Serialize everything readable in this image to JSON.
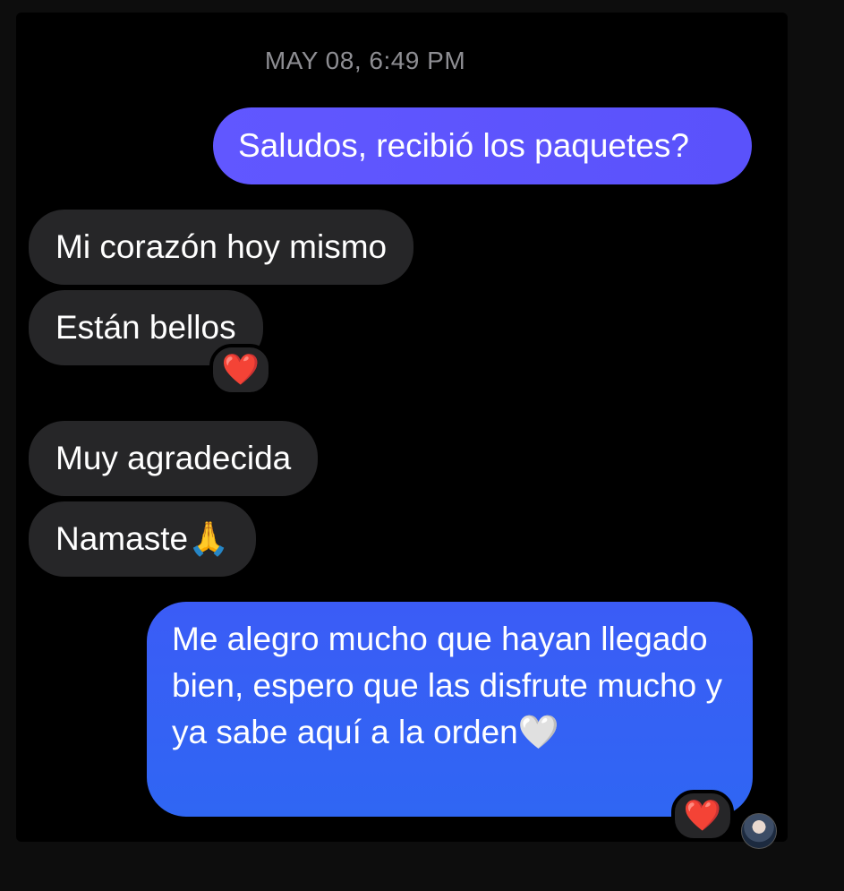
{
  "conversation": {
    "timestamp": "MAY 08, 6:49 PM",
    "messages": [
      {
        "direction": "outgoing",
        "text": "Saludos, recibió los paquetes?"
      },
      {
        "direction": "incoming",
        "text": "Mi corazón hoy mismo"
      },
      {
        "direction": "incoming",
        "text": "Están bellos",
        "reaction": "❤️"
      },
      {
        "direction": "incoming",
        "text": "Muy agradecida"
      },
      {
        "direction": "incoming",
        "text": "Namaste",
        "emoji": "🙏"
      },
      {
        "direction": "outgoing",
        "text": "Me alegro mucho que hayan llegado bien, espero que las disfrute mucho y ya sabe aquí a la orden",
        "emoji": "🤍",
        "reaction": "❤️"
      }
    ],
    "reaction_heart": "❤️"
  },
  "colors": {
    "background": "#000000",
    "incoming_bubble": "#262628",
    "outgoing_bubble_1": "#5f56fe",
    "outgoing_bubble_2": "#3460f4",
    "timestamp_text": "#8e8e93"
  }
}
